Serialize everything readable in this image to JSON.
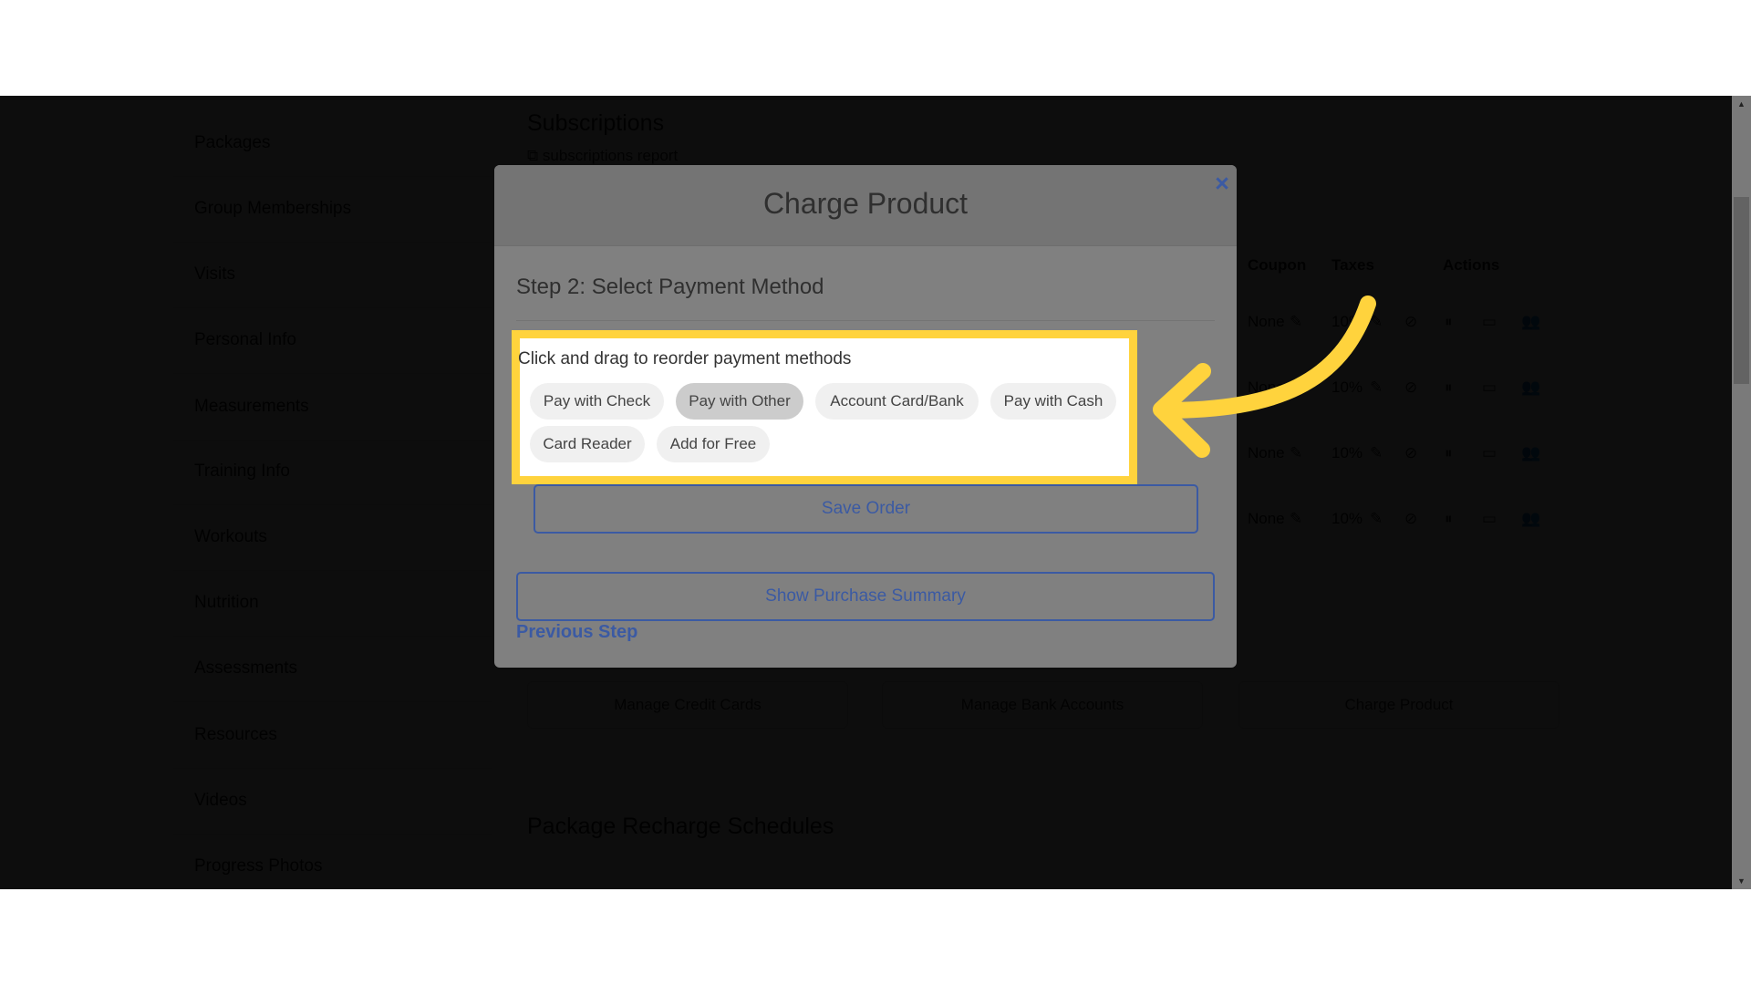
{
  "background": {
    "sidebar": {
      "items": [
        {
          "label": "Packages"
        },
        {
          "label": "Group Memberships"
        },
        {
          "label": "Visits"
        },
        {
          "label": "Personal Info"
        },
        {
          "label": "Measurements"
        },
        {
          "label": "Training Info"
        },
        {
          "label": "Workouts"
        },
        {
          "label": "Nutrition"
        },
        {
          "label": "Assessments"
        },
        {
          "label": "Resources"
        },
        {
          "label": "Videos"
        },
        {
          "label": "Progress Photos"
        }
      ]
    },
    "subscriptions": {
      "title": "Subscriptions",
      "report_link": "subscriptions report",
      "table": {
        "headers": {
          "coupon": "Coupon",
          "taxes": "Taxes",
          "actions": "Actions"
        },
        "rows": [
          {
            "coupon": "None",
            "taxes": "10%"
          },
          {
            "coupon": "None",
            "taxes": "10%"
          },
          {
            "coupon": "None",
            "taxes": "10%"
          },
          {
            "coupon": "None",
            "taxes": "10%"
          }
        ]
      }
    },
    "buttons": {
      "manage_credit_cards": "Manage Credit Cards",
      "manage_bank_accounts": "Manage Bank Accounts",
      "charge_product": "Charge Product"
    },
    "package_recharge_title": "Package Recharge Schedules"
  },
  "icons": {
    "close": "×",
    "edit": "✎",
    "ban": "⊘",
    "pause": "⏸",
    "card": "▭",
    "users": "👥",
    "external_link": "⧉",
    "scroll_up": "▲",
    "scroll_down": "▼"
  },
  "modal": {
    "title": "Charge Product",
    "step_heading": "Step 2: Select Payment Method",
    "instructions": "Click and drag to reorder payment methods",
    "payment_methods": [
      {
        "label": "Pay with Check",
        "active": false
      },
      {
        "label": "Pay with Other",
        "active": true
      },
      {
        "label": "Account Card/Bank",
        "active": false
      },
      {
        "label": "Pay with Cash",
        "active": false
      },
      {
        "label": "Card Reader",
        "active": false
      },
      {
        "label": "Add for Free",
        "active": false
      }
    ],
    "save_order_label": "Save Order",
    "show_summary_label": "Show Purchase Summary",
    "previous_step_label": "Previous Step"
  },
  "colors": {
    "accent_blue": "#3b5aa3",
    "highlight_yellow": "#ffd33d"
  }
}
